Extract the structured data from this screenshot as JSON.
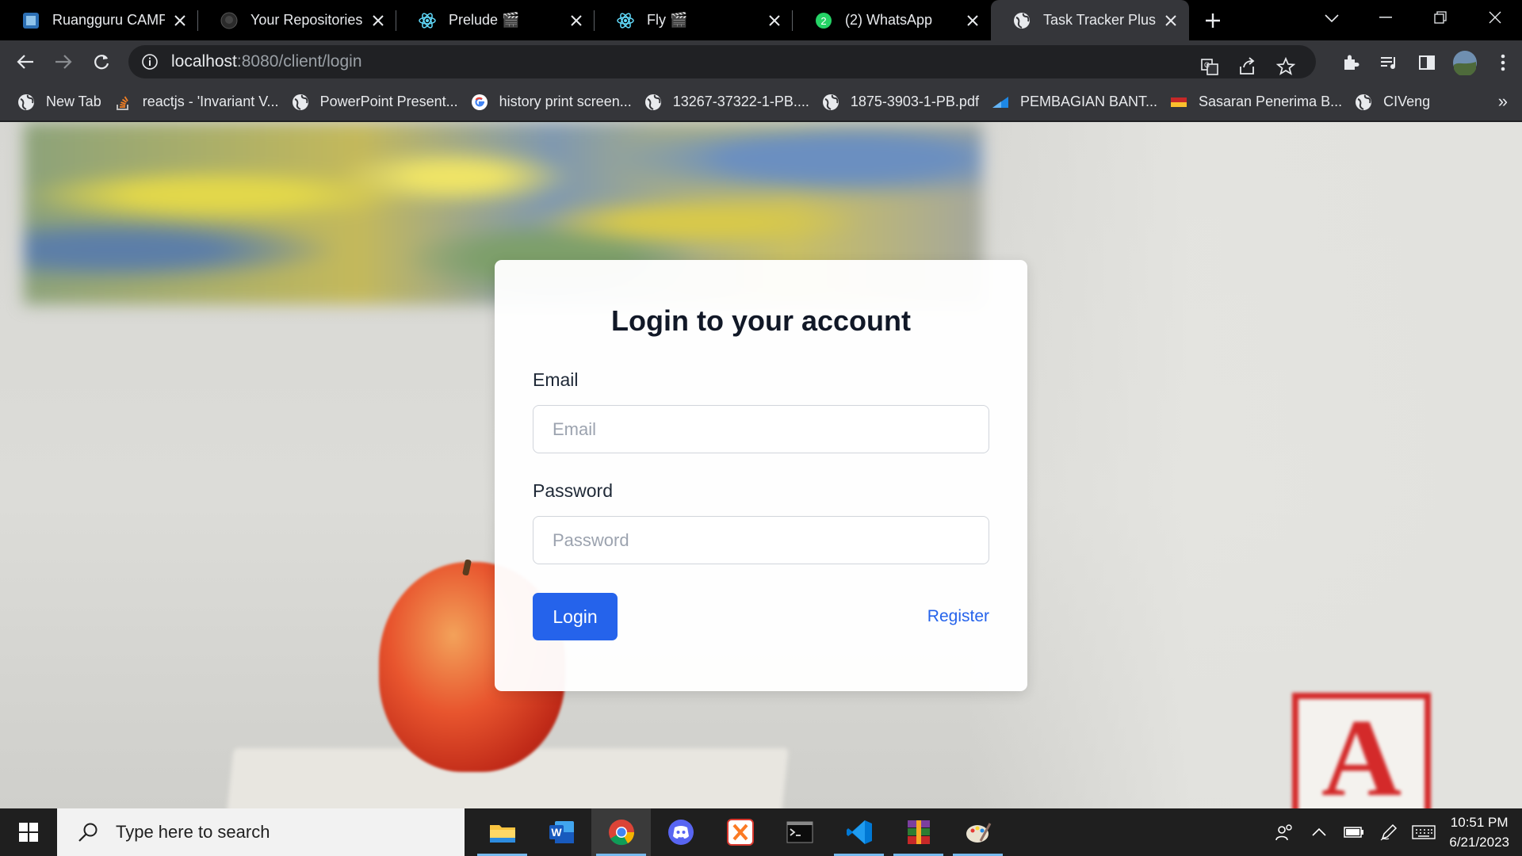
{
  "browser": {
    "tabs": [
      {
        "title": "Ruangguru CAMP",
        "favicon": "ruangguru-icon",
        "active": false
      },
      {
        "title": "Your Repositories",
        "favicon": "github-icon",
        "active": false
      },
      {
        "title": "Prelude 🎬",
        "favicon": "react-icon",
        "active": false
      },
      {
        "title": "Fly 🎬",
        "favicon": "react-icon",
        "active": false
      },
      {
        "title": "(2) WhatsApp",
        "favicon": "whatsapp-icon",
        "badge": "2",
        "active": false
      },
      {
        "title": "Task Tracker Plus",
        "favicon": "globe-icon",
        "active": true
      }
    ],
    "address": {
      "host": "localhost",
      "path": ":8080/client/login"
    },
    "bookmarks": [
      {
        "label": "New Tab",
        "icon": "globe-icon"
      },
      {
        "label": "reactjs - 'Invariant V...",
        "icon": "stackoverflow-icon"
      },
      {
        "label": "PowerPoint Present...",
        "icon": "globe-icon"
      },
      {
        "label": "history print screen...",
        "icon": "google-icon"
      },
      {
        "label": "13267-37322-1-PB....",
        "icon": "globe-icon"
      },
      {
        "label": "1875-3903-1-PB.pdf",
        "icon": "globe-icon"
      },
      {
        "label": "PEMBAGIAN BANT...",
        "icon": "pembagian-icon"
      },
      {
        "label": "Sasaran Penerima B...",
        "icon": "pkh-icon"
      },
      {
        "label": "CIVeng",
        "icon": "globe-icon"
      }
    ],
    "bookmarks_more": "»"
  },
  "login": {
    "title": "Login to your account",
    "email_label": "Email",
    "email_placeholder": "Email",
    "email_value": "",
    "password_label": "Password",
    "password_placeholder": "Password",
    "password_value": "",
    "login_button": "Login",
    "register_link": "Register"
  },
  "taskbar": {
    "search_placeholder": "Type here to search",
    "apps": [
      "file-explorer-icon",
      "word-icon",
      "chrome-icon",
      "discord-icon",
      "xampp-icon",
      "terminal-icon",
      "vscode-icon",
      "winrar-icon",
      "paint-icon"
    ],
    "time": "10:51 PM",
    "date": "6/21/2023"
  },
  "colors": {
    "accent": "#2563eb",
    "tab_active": "#35363a",
    "tabstrip": "#000000",
    "taskbar": "#1f1f1f"
  }
}
